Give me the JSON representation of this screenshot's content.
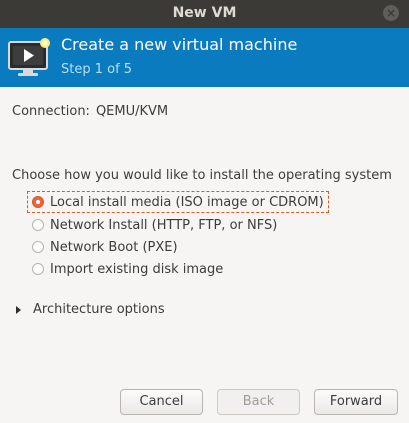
{
  "window": {
    "title": "New VM",
    "close_glyph": "×"
  },
  "header": {
    "icon": "vm-monitor-icon",
    "title": "Create a new virtual machine",
    "step": "Step 1 of 5"
  },
  "connection": {
    "label": "Connection:",
    "value": "QEMU/KVM"
  },
  "install": {
    "prompt": "Choose how you would like to install the operating system",
    "options": [
      {
        "label": "Local install media (ISO image or CDROM)",
        "selected": true
      },
      {
        "label": "Network Install (HTTP, FTP, or NFS)",
        "selected": false
      },
      {
        "label": "Network Boot (PXE)",
        "selected": false
      },
      {
        "label": "Import existing disk image",
        "selected": false
      }
    ]
  },
  "architecture": {
    "label": "Architecture options",
    "expanded": false
  },
  "buttons": {
    "cancel": "Cancel",
    "back": "Back",
    "forward": "Forward"
  },
  "colors": {
    "header_bg": "#0a7bbf",
    "titlebar_bg": "#3b3a37",
    "radio_selected": "#e8693d"
  }
}
